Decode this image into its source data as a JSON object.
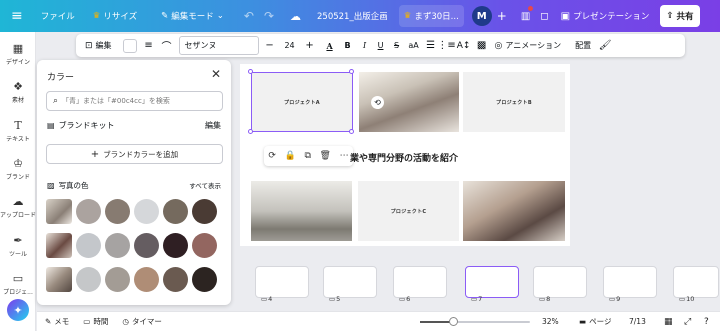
{
  "topbar": {
    "file_label": "ファイル",
    "resize_label": "リサイズ",
    "edit_mode_label": "編集モード",
    "doc_title": "250521_出版企画",
    "upgrade_label": "まず30日...",
    "avatar_letter": "M",
    "present_label": "プレゼンテーション",
    "share_label": "共有"
  },
  "rail": {
    "items": [
      "デザイン",
      "素材",
      "テキスト",
      "ブランド",
      "アップロード",
      "ツール",
      "プロジェ..."
    ]
  },
  "color_panel": {
    "title": "カラー",
    "search_placeholder": "「青」または「#00c4cc」を検索",
    "brand_kit_label": "ブランドキット",
    "brand_kit_edit": "編集",
    "add_brand_color": "ブランドカラーを追加",
    "photo_colors_label": "写真の色",
    "show_all_label": "すべて表示",
    "rows": [
      [
        "#aba39f",
        "#877b71",
        "#d5d7da",
        "#756a5e",
        "#4a3b34"
      ],
      [
        "#c4c7cb",
        "#a6a3a2",
        "#655d61",
        "#2f1f23",
        "#936660"
      ],
      [
        "#c5c7c9",
        "#a39c95",
        "#af8d76",
        "#6a5a50",
        "#2c2421"
      ]
    ]
  },
  "text_toolbar": {
    "edit_label": "編集",
    "font_name": "セザンヌ",
    "font_size": "24",
    "animation_label": "アニメーション",
    "position_label": "配置"
  },
  "canvas": {
    "project_a": "プロジェクトA",
    "project_b": "プロジェクトB",
    "project_c": "プロジェクトC",
    "headline": "業や専門分野の活動を紹介"
  },
  "filmstrip": {
    "pages": [
      "4",
      "5",
      "6",
      "7",
      "8",
      "9",
      "10"
    ]
  },
  "bottombar": {
    "notes_label": "メモ",
    "timing_label": "時間",
    "timer_label": "タイマー",
    "zoom": "32%",
    "pages_label": "ページ",
    "page_count": "7/13"
  },
  "colors": {
    "accent_purple": "#8b3dff",
    "selection": "#8b5cf6"
  }
}
